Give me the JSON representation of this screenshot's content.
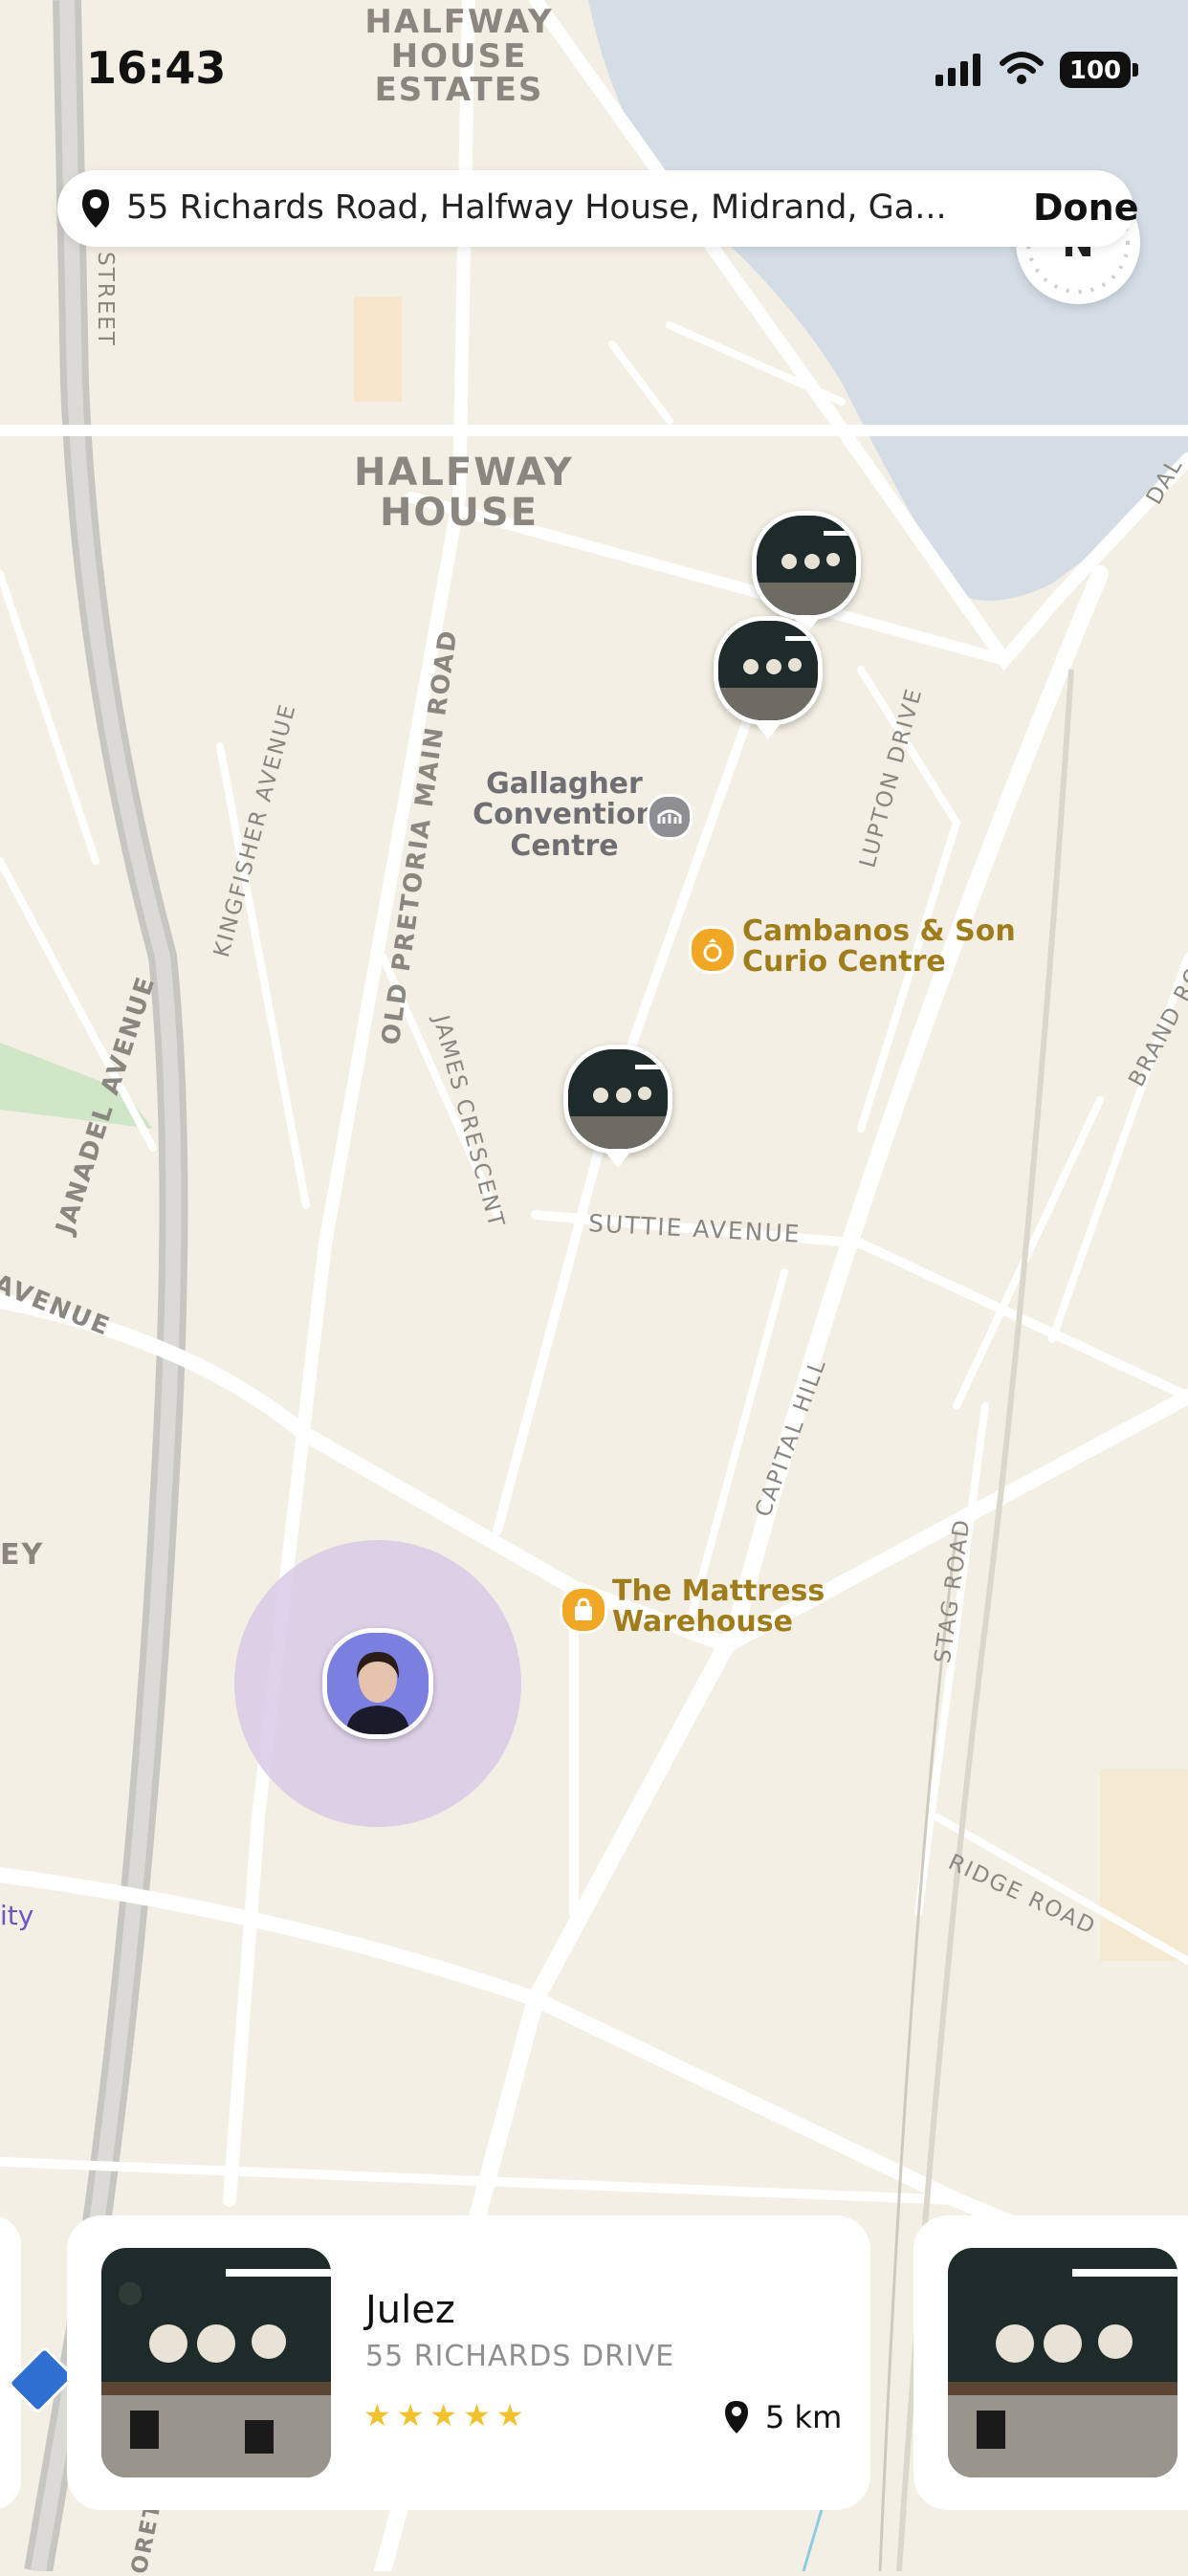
{
  "status_bar": {
    "time": "16:43",
    "battery": "100",
    "icons": [
      "signal-icon",
      "wifi-icon",
      "battery-icon"
    ]
  },
  "search": {
    "address": "55 Richards Road, Halfway House, Midrand, Ga...",
    "done_label": "Done",
    "icon": "location-pin-icon"
  },
  "compass": {
    "label": "N"
  },
  "map": {
    "area_labels": [
      "HALFWAY\nHOUSE\nESTATES",
      "HALFWAY\nHOUSE",
      "EY"
    ],
    "streets": [
      "STREET",
      "KINGFISHER AVENUE",
      "OLD PRETORIA MAIN ROAD",
      "JAMES CRESCENT",
      "JANADEL AVENUE",
      "AVENUE",
      "LUPTON DRIVE",
      "SUTTIE AVENUE",
      "CAPITAL HILL",
      "STAG ROAD",
      "RIDGE ROAD",
      "BRAND RO",
      "DAL",
      "ORET"
    ],
    "pois": [
      {
        "name": "Gallagher\nConvention\nCentre",
        "icon": "stadium-icon",
        "color": "#6e6e73"
      },
      {
        "name": "Cambanos & Son\nCurio Centre",
        "icon": "ring-icon",
        "color": "#a07d1c"
      },
      {
        "name": "The Mattress\nWarehouse",
        "icon": "shopping-bag-icon",
        "color": "#a07d1c"
      }
    ],
    "edge_label": "ity",
    "user_marker": "user-avatar"
  },
  "cards": [
    {
      "title": "Julez",
      "address": "55 RICHARDS DRIVE",
      "rating_stars": "★★★★★",
      "rating": 5,
      "distance": "5 km"
    }
  ],
  "colors": {
    "map_bg": "#f4efe4",
    "water": "#d4dde6",
    "road": "#ffffff",
    "highway": "#c8c6c2",
    "accuracy_circle": "#d8c9e6",
    "star": "#f2c12e",
    "poi_gold": "#a07d1c"
  }
}
